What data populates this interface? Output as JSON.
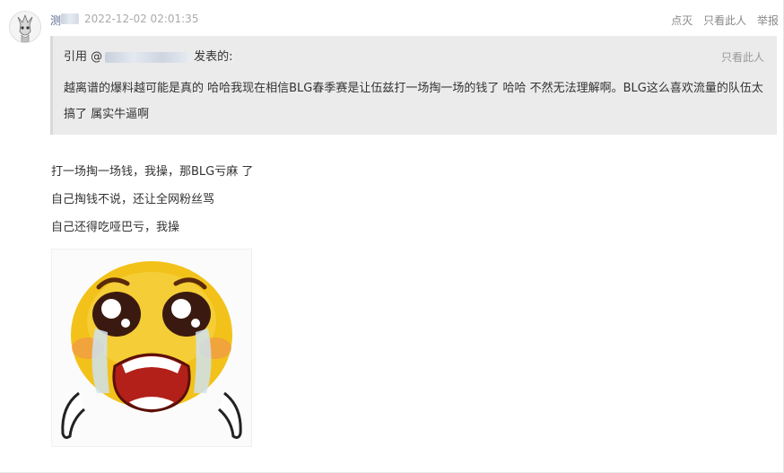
{
  "post": {
    "author_prefix": "测",
    "timestamp": "2022-12-02 02:01:35",
    "actions": [
      "点灭",
      "只看此人",
      "举报"
    ]
  },
  "quote": {
    "prefix": "引用 @",
    "suffix": "发表的:",
    "only_this_person": "只看此人",
    "text": "越离谱的爆料越可能是真的 哈哈我现在相信BLG春季赛是让伍兹打一场掏一场的钱了 哈哈 不然无法理解啊。BLG这么喜欢流量的队伍太搞了 属实牛逼啊"
  },
  "reply_lines": [
    "打一场掏一场钱，我操，那BLG亏麻 了",
    "自己掏钱不说，还让全网粉丝骂",
    "自己还得吃哑巴亏，我操"
  ],
  "colors": {
    "quote_bg": "#ebebeb",
    "emoji_face": "#f2c21a",
    "emoji_mouth": "#b3201a",
    "tears": "#cfe2ef"
  },
  "icons": {
    "avatar": "anime-avatar-icon",
    "sticker": "crying-emoji-icon"
  }
}
